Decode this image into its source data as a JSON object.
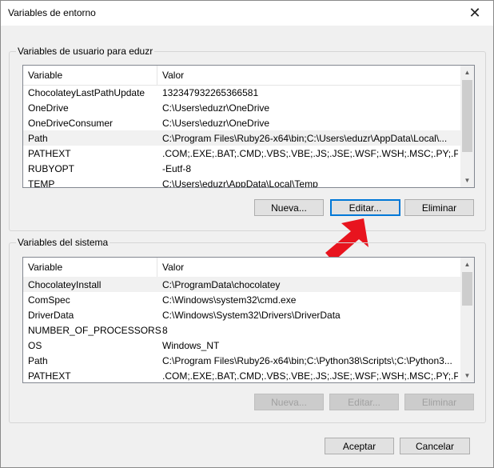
{
  "window": {
    "title": "Variables de entorno"
  },
  "user_vars": {
    "label": "Variables de usuario para eduzr",
    "headers": {
      "variable": "Variable",
      "valor": "Valor"
    },
    "rows": [
      {
        "name": "ChocolateyLastPathUpdate",
        "value": "132347932265366581"
      },
      {
        "name": "OneDrive",
        "value": "C:\\Users\\eduzr\\OneDrive"
      },
      {
        "name": "OneDriveConsumer",
        "value": "C:\\Users\\eduzr\\OneDrive"
      },
      {
        "name": "Path",
        "value": "C:\\Program Files\\Ruby26-x64\\bin;C:\\Users\\eduzr\\AppData\\Local\\..."
      },
      {
        "name": "PATHEXT",
        "value": ".COM;.EXE;.BAT;.CMD;.VBS;.VBE;.JS;.JSE;.WSF;.WSH;.MSC;.PY;.PYW;..."
      },
      {
        "name": "RUBYOPT",
        "value": "-Eutf-8"
      },
      {
        "name": "TEMP",
        "value": "C:\\Users\\eduzr\\AppData\\Local\\Temp"
      }
    ],
    "buttons": {
      "new": "Nueva...",
      "edit": "Editar...",
      "delete": "Eliminar"
    }
  },
  "system_vars": {
    "label": "Variables del sistema",
    "headers": {
      "variable": "Variable",
      "valor": "Valor"
    },
    "rows": [
      {
        "name": "ChocolateyInstall",
        "value": "C:\\ProgramData\\chocolatey"
      },
      {
        "name": "ComSpec",
        "value": "C:\\Windows\\system32\\cmd.exe"
      },
      {
        "name": "DriverData",
        "value": "C:\\Windows\\System32\\Drivers\\DriverData"
      },
      {
        "name": "NUMBER_OF_PROCESSORS",
        "value": "8"
      },
      {
        "name": "OS",
        "value": "Windows_NT"
      },
      {
        "name": "Path",
        "value": "C:\\Program Files\\Ruby26-x64\\bin;C:\\Python38\\Scripts\\;C:\\Python3..."
      },
      {
        "name": "PATHEXT",
        "value": ".COM;.EXE;.BAT;.CMD;.VBS;.VBE;.JS;.JSE;.WSF;.WSH;.MSC;.PY;.PYW;..."
      }
    ],
    "buttons": {
      "new": "Nueva...",
      "edit": "Editar...",
      "delete": "Eliminar"
    }
  },
  "dialog_buttons": {
    "ok": "Aceptar",
    "cancel": "Cancelar"
  },
  "colors": {
    "accent": "#0078d7",
    "annotation_arrow": "#e8141e"
  },
  "icons": {
    "close": "close-icon",
    "annotation": "red-arrow-icon"
  }
}
